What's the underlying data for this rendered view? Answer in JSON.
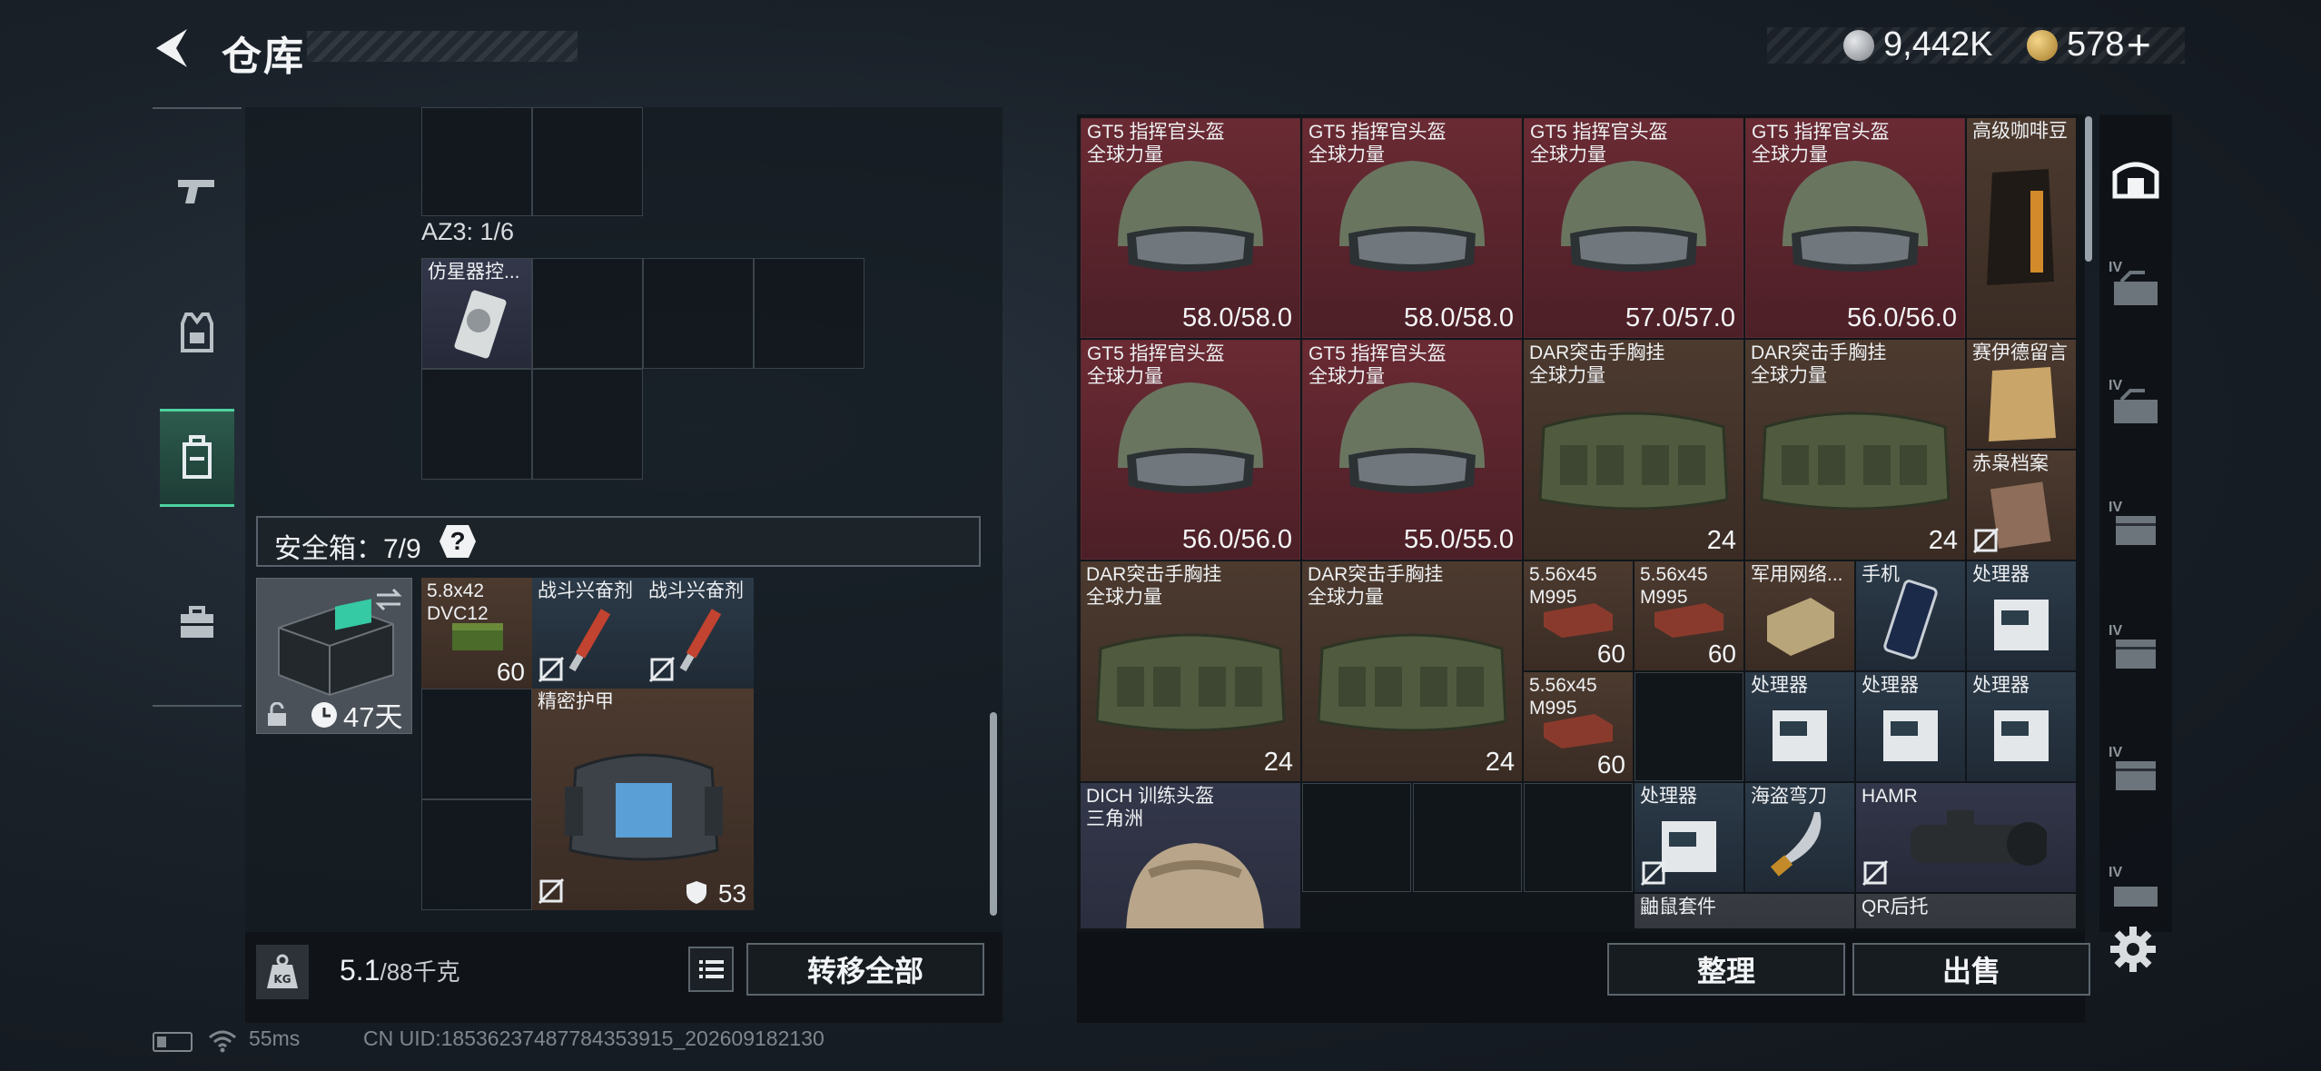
{
  "header": {
    "title": "仓库",
    "currency_silver": "9,442K",
    "currency_gold": "578",
    "plus": "+"
  },
  "nav": {
    "items": [
      "weapon",
      "equipment",
      "backpack",
      "toolbox"
    ],
    "active": "backpack"
  },
  "left": {
    "az3_label": "AZ3: 1/6",
    "az3_item": "仿星器控...",
    "safe_label": "安全箱：7/9",
    "safe_help": "?",
    "safebox_days": "47天",
    "items": [
      {
        "label": "5.8x42\nDVC12",
        "count": "60"
      },
      {
        "label": "战斗兴奋剂"
      },
      {
        "label": "战斗兴奋剂"
      },
      {
        "label": "精密护甲",
        "durability": "53"
      }
    ],
    "weight": "5.1",
    "weight_max": "/88千克",
    "transfer_all": "转移全部"
  },
  "right": {
    "items": [
      {
        "label": "GT5 指挥官头盔\n全球力量",
        "durability": "58.0/58.0"
      },
      {
        "label": "GT5 指挥官头盔\n全球力量",
        "durability": "58.0/58.0"
      },
      {
        "label": "GT5 指挥官头盔\n全球力量",
        "durability": "57.0/57.0"
      },
      {
        "label": "GT5 指挥官头盔\n全球力量",
        "durability": "56.0/56.0"
      },
      {
        "label": "高级咖啡豆"
      },
      {
        "label": "GT5 指挥官头盔\n全球力量",
        "durability": "56.0/56.0"
      },
      {
        "label": "GT5 指挥官头盔\n全球力量",
        "durability": "55.0/55.0"
      },
      {
        "label": "DAR突击手胸挂\n全球力量",
        "stack": "24"
      },
      {
        "label": "DAR突击手胸挂\n全球力量",
        "stack": "24"
      },
      {
        "label": "赛伊德留言"
      },
      {
        "label": "赤枭档案"
      },
      {
        "label": "DAR突击手胸挂\n全球力量",
        "stack": "24"
      },
      {
        "label": "DAR突击手胸挂\n全球力量",
        "stack": "24"
      },
      {
        "label": "5.56x45\nM995",
        "count": "60"
      },
      {
        "label": "5.56x45\nM995",
        "count": "60"
      },
      {
        "label": "军用网络..."
      },
      {
        "label": "手机"
      },
      {
        "label": "处理器"
      },
      {
        "label": "5.56x45\nM995",
        "count": "60"
      },
      {
        "label": "处理器"
      },
      {
        "label": "处理器"
      },
      {
        "label": "处理器"
      },
      {
        "label": "DICH 训练头盔\n三角洲"
      },
      {
        "label": "处理器"
      },
      {
        "label": "海盗弯刀"
      },
      {
        "label": "HAMR"
      },
      {
        "label": "鼬鼠套件"
      },
      {
        "label": "QR后托"
      }
    ],
    "organize": "整理",
    "sell": "出售",
    "side_tab_label": "IV"
  },
  "status": {
    "ping": "55ms",
    "uid": "CN UID:18536237487784353915_202609182130"
  },
  "colors": {
    "accent": "#4fd1a0",
    "red_rarity": "#6a2a33",
    "brown_rarity": "#4c3a2f",
    "blue_rarity": "#2c3a48"
  }
}
